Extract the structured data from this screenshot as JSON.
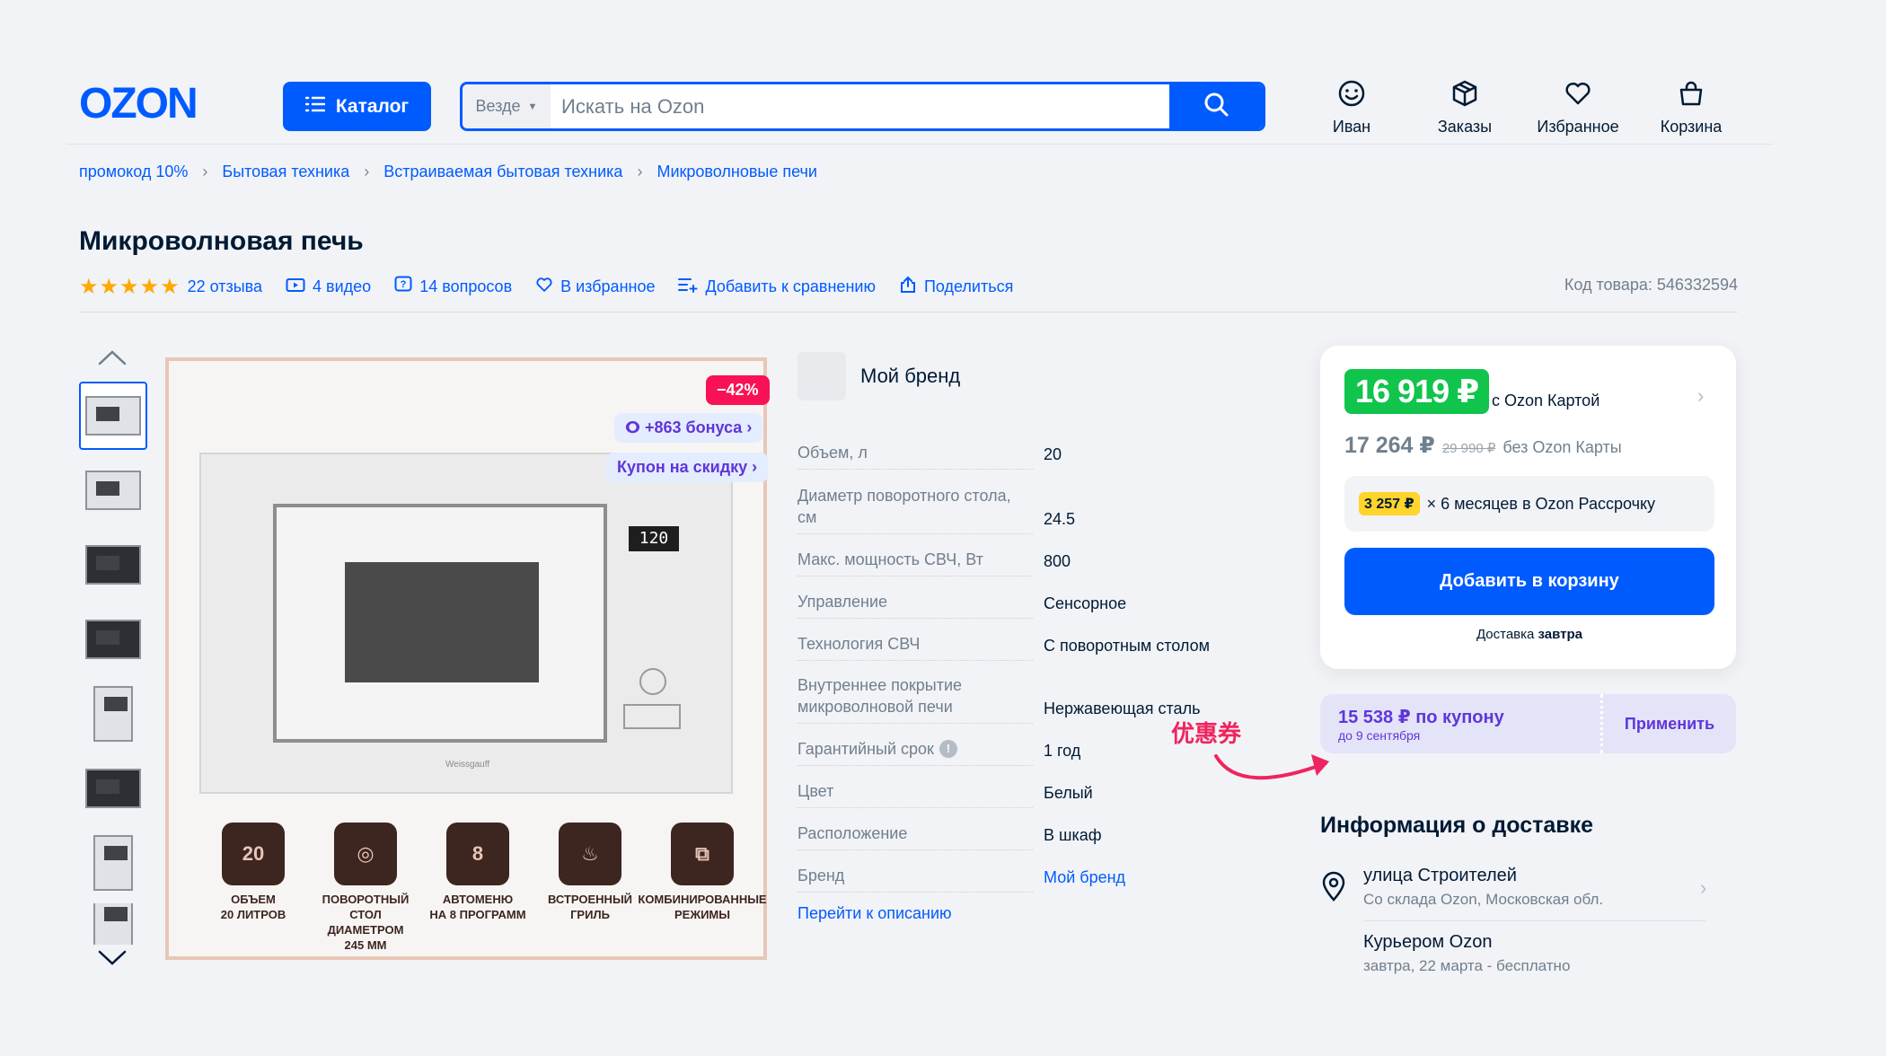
{
  "header": {
    "logo": "OZON",
    "catalog_label": "Каталог",
    "search_scope": "Везде",
    "search_placeholder": "Искать на Ozon",
    "nav": [
      {
        "label": "Иван",
        "icon": "smiley-icon"
      },
      {
        "label": "Заказы",
        "icon": "box-icon"
      },
      {
        "label": "Избранное",
        "icon": "heart-icon"
      },
      {
        "label": "Корзина",
        "icon": "bag-icon"
      }
    ]
  },
  "breadcrumbs": [
    "промокод 10%",
    "Бытовая техника",
    "Встраиваемая бытовая техника",
    "Микроволновые печи"
  ],
  "product": {
    "title": "Микроволновая печь",
    "rating_stars": 5,
    "reviews": "22 отзыва",
    "videos": "4 видео",
    "questions": "14 вопросов",
    "favorite": "В избранное",
    "compare": "Добавить к сравнению",
    "share": "Поделиться",
    "sku": "Код товара: 546332594"
  },
  "gallery": {
    "discount_badge": "−42%",
    "bonus": "+863 бонуса",
    "coupon_tag": "Купон на скидку",
    "display": "120",
    "oven_brand": "Weissgauff",
    "features": [
      {
        "icon_text": "20",
        "label": "ОБЪЕМ\n20 ЛИТРОВ"
      },
      {
        "icon_text": "◎",
        "label": "ПОВОРОТНЫЙ\nСТОЛ ДИАМЕТРОМ\n245 ММ"
      },
      {
        "icon_text": "8",
        "label": "АВТОМЕНЮ\nНА 8 ПРОГРАММ"
      },
      {
        "icon_text": "♨",
        "label": "ВСТРОЕННЫЙ\nГРИЛЬ"
      },
      {
        "icon_text": "⧉",
        "label": "КОМБИНИРОВАННЫЕ\nРЕЖИМЫ"
      }
    ]
  },
  "brand": "Мой бренд",
  "specs": [
    {
      "key": "Объем, л",
      "value": "20"
    },
    {
      "key": "Диаметр поворотного стола, см",
      "value": "24.5"
    },
    {
      "key": "Макс. мощность СВЧ, Вт",
      "value": "800"
    },
    {
      "key": "Управление",
      "value": "Сенсорное"
    },
    {
      "key": "Технология СВЧ",
      "value": "С поворотным столом"
    },
    {
      "key": "Внутреннее покрытие микроволновой печи",
      "value": "Нержавеющая сталь"
    },
    {
      "key": "Гарантийный срок",
      "value": "1 год"
    },
    {
      "key": "Цвет",
      "value": "Белый"
    },
    {
      "key": "Расположение",
      "value": "В шкаф"
    },
    {
      "key": "Бренд",
      "value": "Мой бренд"
    }
  ],
  "goto_description": "Перейти к описанию",
  "price": {
    "card_price": "16 919 ₽",
    "card_label": "с Ozon Картой",
    "regular_price": "17 264 ₽",
    "old_price": "29 990 ₽",
    "regular_label": "без Ozon Карты",
    "installment_amount": "3 257 ₽",
    "installment_text": "× 6 месяцев в Ozon Рассрочку",
    "add_to_cart": "Добавить в корзину",
    "delivery_prefix": "Доставка",
    "delivery_day": "завтра"
  },
  "coupon": {
    "price": "15 538 ₽ по купону",
    "until": "до 9 сентября",
    "apply": "Применить"
  },
  "annotation": "优惠券",
  "delivery_info": {
    "title": "Информация о доставке",
    "address": "улица Строителей",
    "warehouse": "Со склада Ozon, Московская обл.",
    "courier": "Курьером Ozon",
    "courier_when": "завтра, 22 марта - бесплатно"
  },
  "colors": {
    "brand_blue": "#005bff",
    "price_green": "#10c44c",
    "discount_pink": "#f91155",
    "coupon_purple": "#5f36d9"
  }
}
